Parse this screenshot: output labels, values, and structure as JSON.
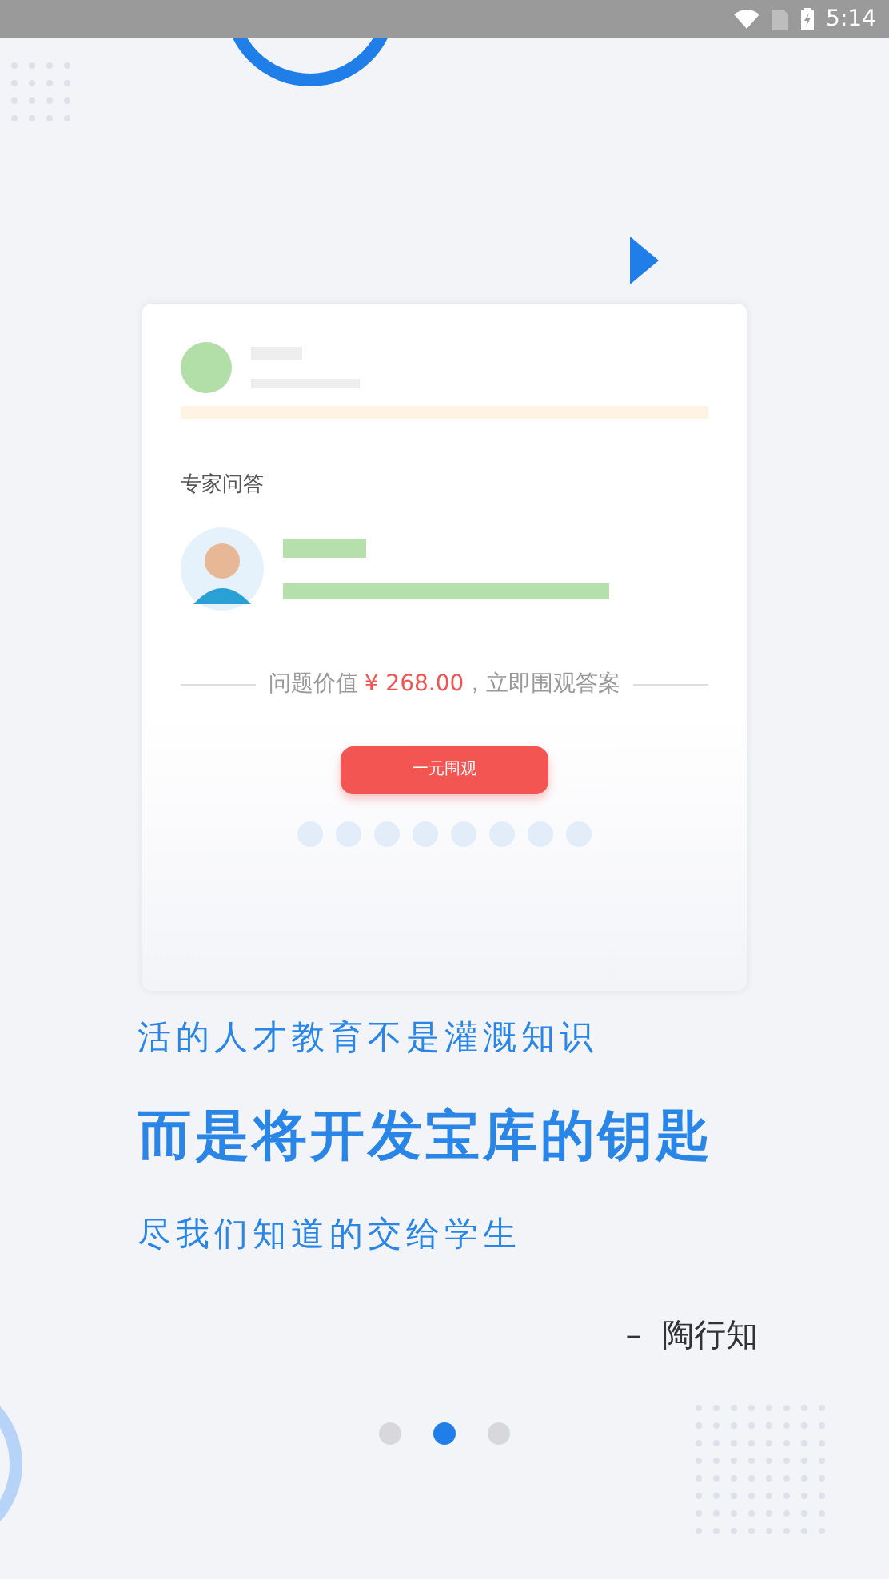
{
  "status_bar": {
    "time": "5:14"
  },
  "card": {
    "section_title": "专家问答",
    "price_line": {
      "prefix": "问题价值",
      "price": "¥ 268.00",
      "suffix": "，立即围观答案"
    },
    "button": "一元围观"
  },
  "quote": {
    "lines": [
      "活的人才教育不是灌溉知识",
      "而是将开发宝库的钥匙",
      "尽我们知道的交给学生"
    ],
    "author": "–  陶行知"
  },
  "pager": [
    {
      "selected": false
    },
    {
      "selected": true
    },
    {
      "selected": false
    }
  ]
}
